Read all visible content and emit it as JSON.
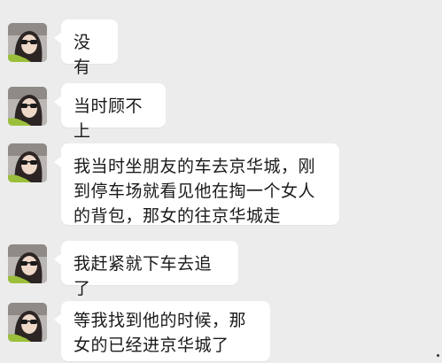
{
  "messages": [
    {
      "text": "没有"
    },
    {
      "text": "当时顾不上"
    },
    {
      "text": "我当时坐朋友的车去京华城，刚到停车场就看见他在掏一个女人的背包，那女的往京华城走"
    },
    {
      "text": "我赶紧就下车去追了"
    },
    {
      "text": "等我找到他的时候，那女的已经进京华城了"
    }
  ]
}
